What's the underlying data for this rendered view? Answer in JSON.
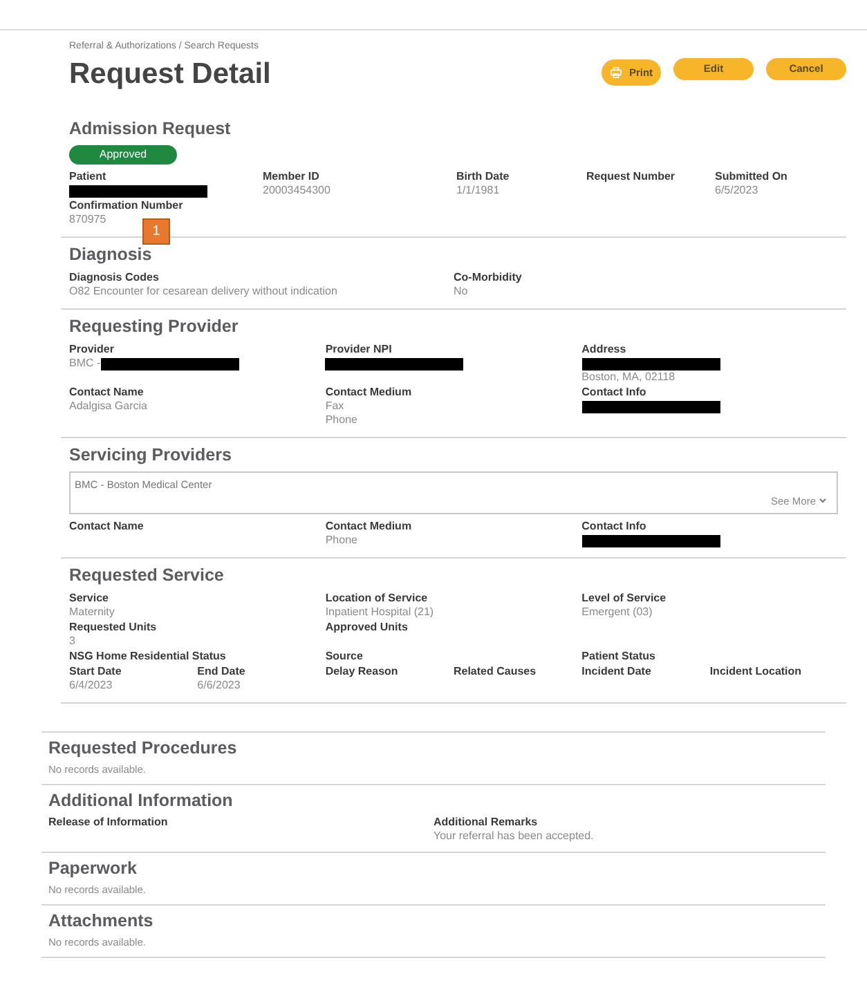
{
  "breadcrumb": "Referral & Authorizations / Search Requests",
  "title": "Request Detail",
  "buttons": [
    {
      "label": "Print",
      "kind": "print"
    },
    {
      "label": "Edit",
      "kind": "plain"
    },
    {
      "label": "Cancel",
      "kind": "plain"
    }
  ],
  "annotation_marker": "1",
  "sections": [
    {
      "title": "Admission Request",
      "status": "Approved",
      "rows": [
        {
          "kind": "summary",
          "fields": [
            {
              "label": "Patient",
              "lines": [
                {
                  "redacted": true
                }
              ]
            },
            {
              "label": "Member ID",
              "lines": [
                {
                  "text": "20003454300"
                }
              ]
            },
            {
              "label": "Birth Date",
              "lines": [
                {
                  "text": "1/1/1981"
                }
              ]
            },
            {
              "label": "Request Number"
            },
            {
              "label": "Submitted On",
              "lines": [
                {
                  "text": "6/5/2023"
                }
              ]
            }
          ]
        },
        {
          "kind": "halves",
          "fields": [
            {
              "label": "Confirmation Number",
              "lines": [
                {
                  "text": "870975"
                }
              ]
            }
          ]
        }
      ]
    },
    {
      "title": "Diagnosis",
      "rows": [
        {
          "kind": "halves",
          "fields": [
            {
              "label": "Diagnosis Codes",
              "lines": [
                {
                  "text": "O82 Encounter for cesarean delivery without indication"
                }
              ]
            },
            {
              "label": "Co-Morbidity",
              "lines": [
                {
                  "text": "No"
                }
              ]
            }
          ]
        }
      ]
    },
    {
      "title": "Requesting Provider",
      "rows": [
        {
          "kind": "thirds",
          "fields": [
            {
              "label": "Provider",
              "lines": [
                {
                  "text": "BMC - ",
                  "redacted": true
                }
              ]
            },
            {
              "label": "Provider NPI",
              "lines": [
                {
                  "redacted": true
                }
              ]
            },
            {
              "label": "Address",
              "lines": [
                {
                  "redacted": true
                },
                {
                  "text": "Boston, MA, 02118"
                }
              ]
            }
          ]
        },
        {
          "kind": "thirds",
          "fields": [
            {
              "label": "Contact Name",
              "lines": [
                {
                  "text": "Adalgisa Garcia"
                }
              ]
            },
            {
              "label": "Contact Medium",
              "lines": [
                {
                  "text": "Fax"
                },
                {
                  "text": "Phone"
                }
              ]
            },
            {
              "label": "Contact Info",
              "lines": [
                {
                  "redacted": true
                }
              ]
            }
          ]
        }
      ]
    },
    {
      "title": "Servicing Providers",
      "box": {
        "text": "BMC - Boston Medical Center",
        "link": "See More"
      },
      "rows": [
        {
          "kind": "thirds",
          "fields": [
            {
              "label": "Contact Name"
            },
            {
              "label": "Contact Medium",
              "lines": [
                {
                  "text": "Phone"
                }
              ]
            },
            {
              "label": "Contact Info",
              "lines": [
                {
                  "redacted": true
                }
              ]
            }
          ]
        }
      ]
    },
    {
      "title": "Requested Service",
      "rows": [
        {
          "kind": "thirds",
          "fields": [
            {
              "label": "Service",
              "lines": [
                {
                  "text": "Maternity"
                }
              ]
            },
            {
              "label": "Location of Service",
              "lines": [
                {
                  "text": "Inpatient Hospital (21)"
                }
              ]
            },
            {
              "label": "Level of Service",
              "lines": [
                {
                  "text": "Emergent (03)"
                }
              ]
            }
          ]
        },
        {
          "kind": "thirds",
          "fields": [
            {
              "label": "Requested Units",
              "lines": [
                {
                  "text": "3"
                }
              ]
            },
            {
              "label": "Approved Units"
            }
          ]
        },
        {
          "kind": "thirds",
          "fields": [
            {
              "label": "NSG Home Residential Status"
            },
            {
              "label": "Source"
            },
            {
              "label": "Patient Status"
            }
          ]
        },
        {
          "kind": "sixths",
          "fields": [
            {
              "label": "Start Date",
              "lines": [
                {
                  "text": "6/4/2023"
                }
              ]
            },
            {
              "label": "End Date",
              "lines": [
                {
                  "text": "6/6/2023"
                }
              ]
            },
            {
              "label": "Delay Reason"
            },
            {
              "label": "Related Causes"
            },
            {
              "label": "Incident Date"
            },
            {
              "label": "Incident Location"
            }
          ]
        }
      ]
    }
  ],
  "lower_sections": [
    {
      "title": "Requested Procedures",
      "empty_text": "No records available."
    },
    {
      "title": "Additional Information",
      "rows": [
        {
          "kind": "halves",
          "fields": [
            {
              "label": "Release of Information"
            },
            {
              "label": "Additional Remarks",
              "lines": [
                {
                  "text": "Your referral has been accepted."
                }
              ]
            }
          ]
        }
      ]
    },
    {
      "title": "Paperwork",
      "empty_text": "No records available."
    },
    {
      "title": "Attachments",
      "empty_text": "No records available."
    }
  ]
}
